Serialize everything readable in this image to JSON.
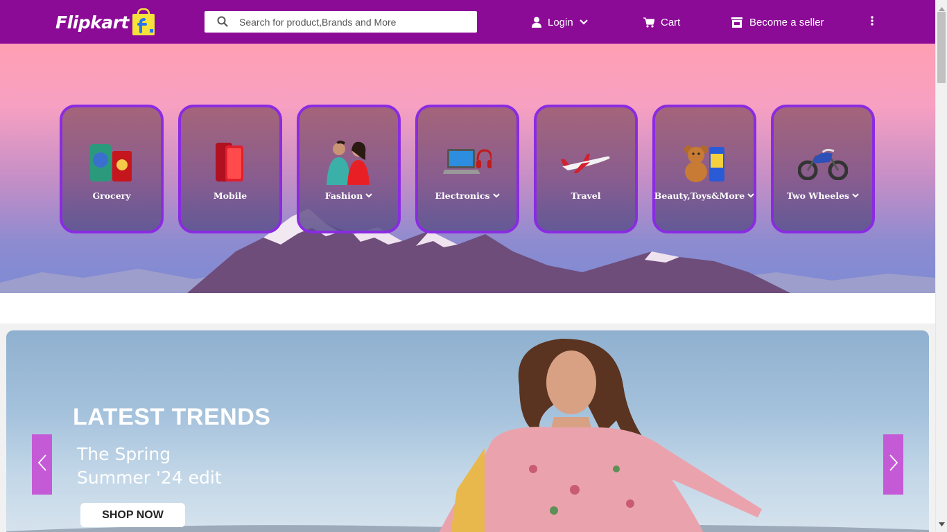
{
  "header": {
    "logo_text": "Flipkart",
    "search": {
      "placeholder": "Search for product,Brands and More",
      "value": ""
    },
    "login_label": "Login",
    "cart_label": "Cart",
    "seller_label": "Become a seller",
    "icons": [
      "search-icon",
      "user-icon",
      "chevron-down-icon",
      "cart-icon",
      "store-icon",
      "more-vertical-icon"
    ]
  },
  "categories": [
    {
      "label": "Grocery",
      "has_dropdown": false,
      "icon": "grocery-icon"
    },
    {
      "label": "Mobile",
      "has_dropdown": false,
      "icon": "mobile-icon"
    },
    {
      "label": "Fashion",
      "has_dropdown": true,
      "icon": "fashion-icon"
    },
    {
      "label": "Electronics",
      "has_dropdown": true,
      "icon": "electronics-icon"
    },
    {
      "label": "Travel",
      "has_dropdown": false,
      "icon": "airplane-icon"
    },
    {
      "label": "Beauty,Toys&More",
      "has_dropdown": true,
      "icon": "toys-icon"
    },
    {
      "label": "Two Wheeles",
      "has_dropdown": true,
      "icon": "motorbike-icon"
    }
  ],
  "banner": {
    "title": "LATEST TRENDS",
    "subtitle": "The Spring\nSummer '24 edit",
    "cta_label": "SHOP NOW"
  },
  "colors": {
    "header_bg": "#8b0b96",
    "card_border": "#8a2be2",
    "carousel_arrow": "#c55ad6"
  }
}
